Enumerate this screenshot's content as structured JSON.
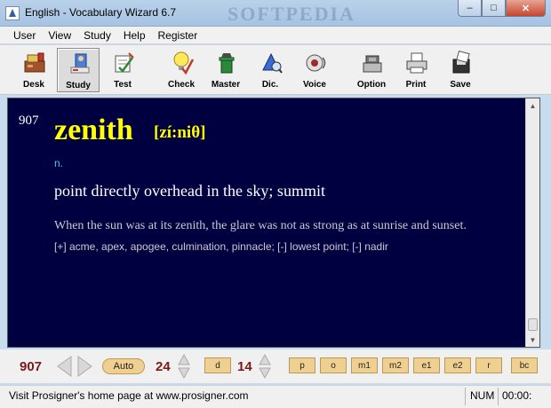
{
  "window": {
    "title": "English - Vocabulary Wizard 6.7",
    "watermark": "SOFTPEDIA",
    "minimize": "–",
    "maximize": "□",
    "close": "✕"
  },
  "menu": [
    "User",
    "View",
    "Study",
    "Help",
    "Register"
  ],
  "toolbar": {
    "desk": "Desk",
    "study": "Study",
    "test": "Test",
    "check": "Check",
    "master": "Master",
    "dic": "Dic.",
    "voice": "Voice",
    "option": "Option",
    "print": "Print",
    "save": "Save",
    "active": "Study"
  },
  "entry": {
    "number": "907",
    "word": "zenith",
    "phonetic": "[zí:niθ]",
    "pos": "n.",
    "definition": "point directly overhead in the sky; summit",
    "example": "When the sun was at its zenith, the glare was not as strong as at sunrise and sunset.",
    "synonyms": "[+] acme, apex, apogee, culmination, pinnacle; [-] lowest point; [-] nadir"
  },
  "controls": {
    "count": "907",
    "auto": "Auto",
    "value1": "24",
    "d": "d",
    "value2": "14",
    "buttons": [
      "p",
      "o",
      "m1",
      "m2",
      "e1",
      "e2",
      "r",
      "bc"
    ]
  },
  "status": {
    "text": "Visit Prosigner's home page at www.prosigner.com",
    "num": "NUM",
    "time": "00:00:"
  },
  "colors": {
    "background": "#000040",
    "headword": "#ffff00",
    "pos": "#3ec9e8",
    "accent_button": "#f0d090",
    "count": "#7a1a1a"
  }
}
